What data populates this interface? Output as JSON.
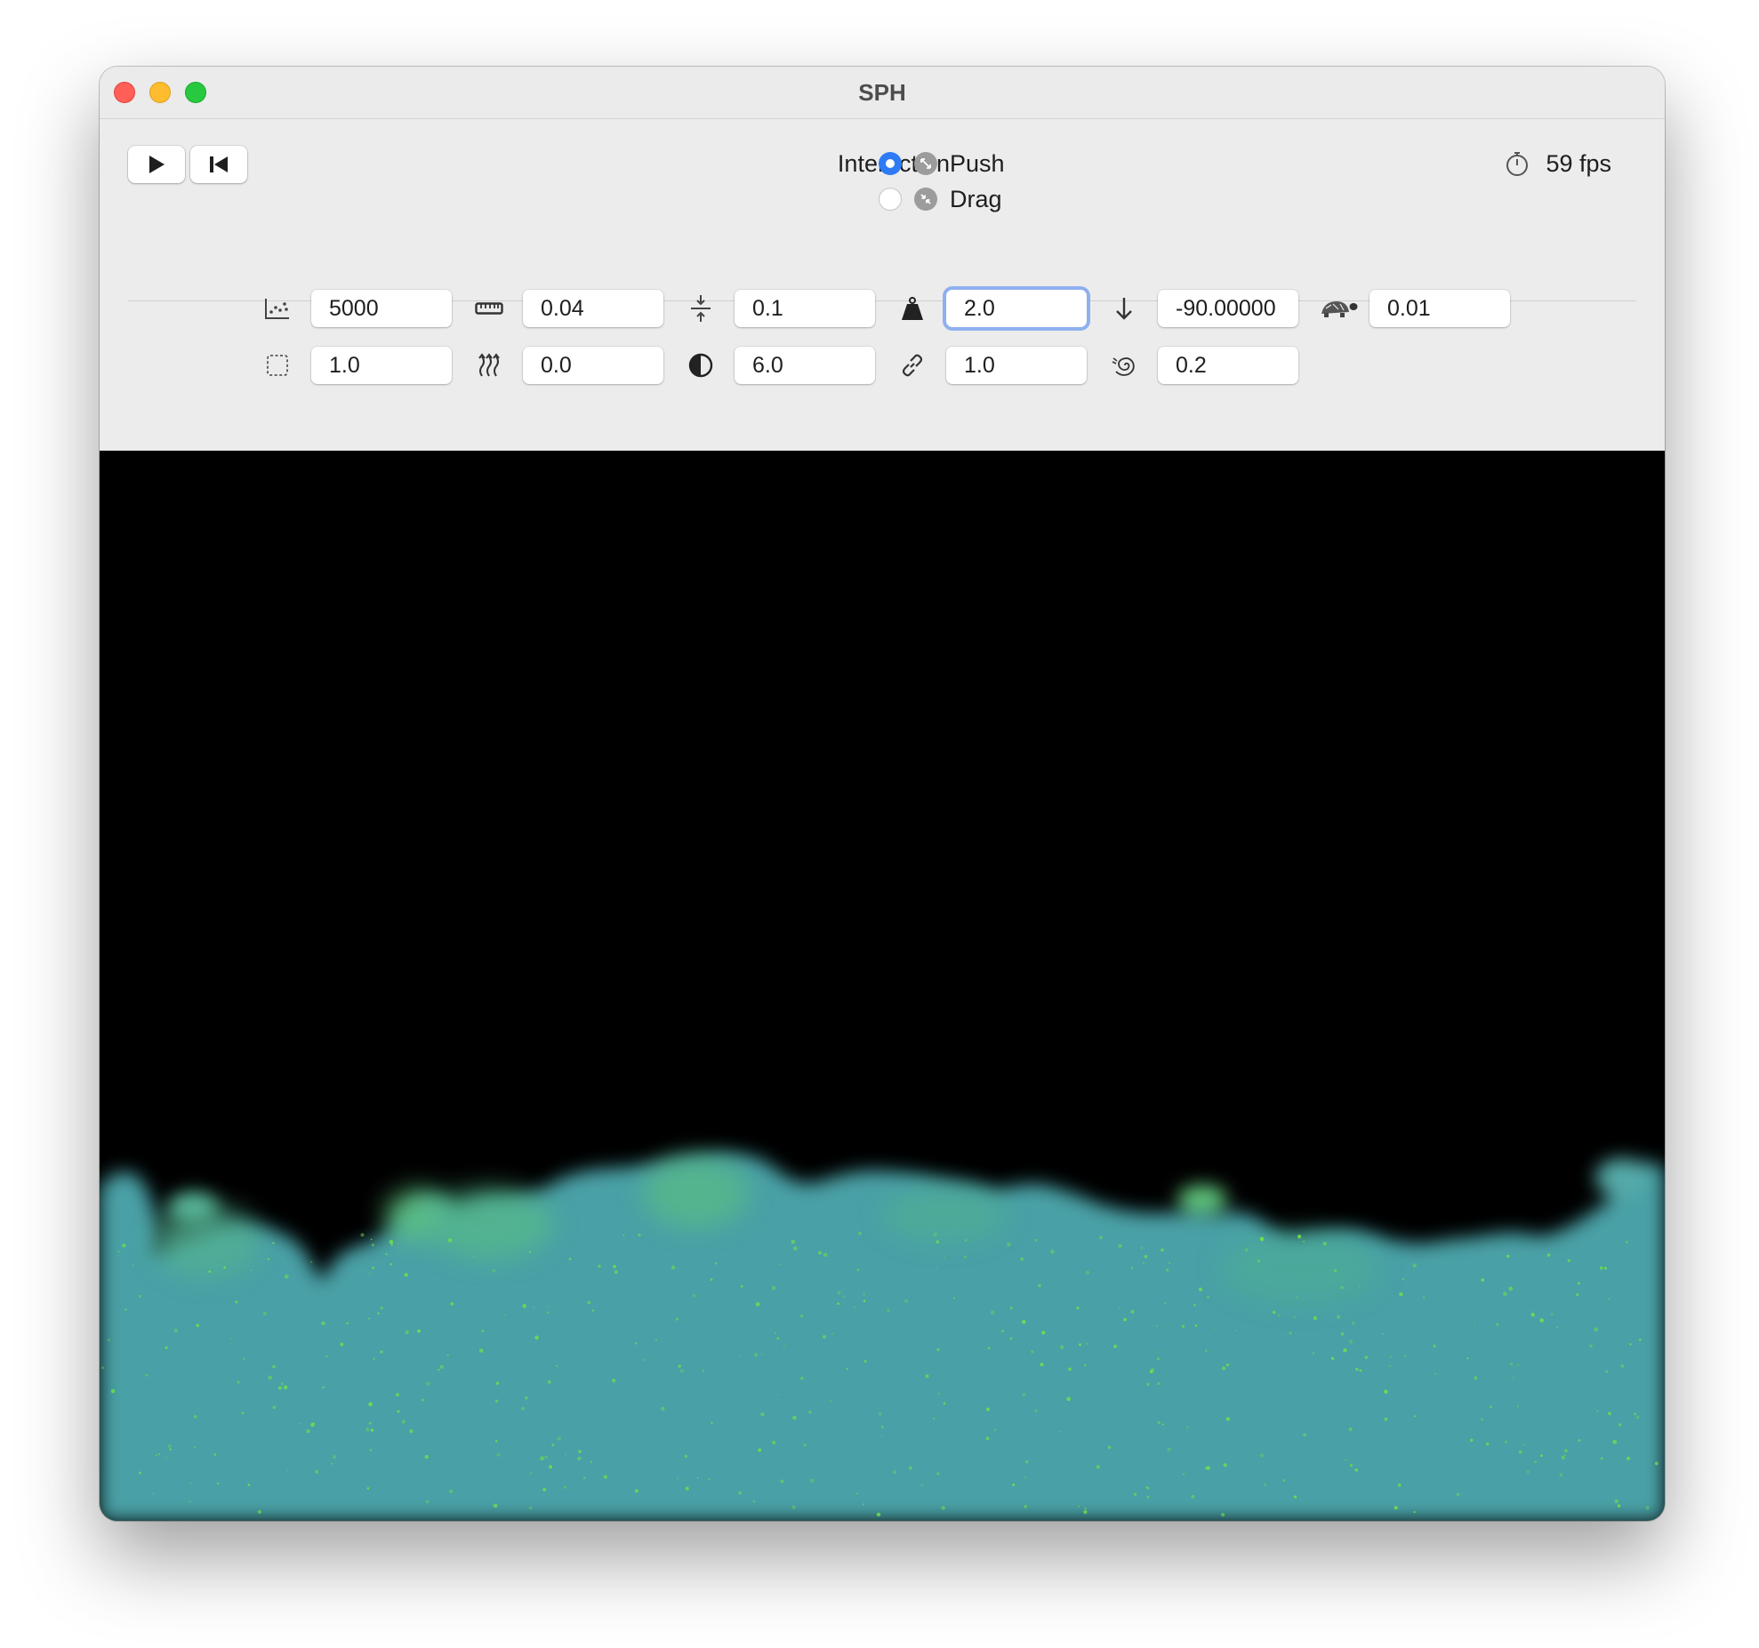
{
  "window": {
    "title": "SPH"
  },
  "toolbar": {
    "interaction_label": "Interaction",
    "modes": [
      {
        "label": "Push",
        "selected": true,
        "icon": "arrows-expand-icon"
      },
      {
        "label": "Drag",
        "selected": false,
        "icon": "arrows-collapse-icon"
      }
    ],
    "fps": "59 fps",
    "accent_color": "#2f7bf6"
  },
  "params": {
    "row1": [
      {
        "icon": "scatter-chart-icon",
        "value": "5000"
      },
      {
        "icon": "ruler-icon",
        "value": "0.04"
      },
      {
        "icon": "arrows-converge-icon",
        "value": "0.1"
      },
      {
        "icon": "weight-icon",
        "value": "2.0",
        "focused": true
      },
      {
        "icon": "arrow-down-icon",
        "value": "-90.00000"
      },
      {
        "icon": "tortoise-icon",
        "value": "0.01"
      }
    ],
    "row2": [
      {
        "icon": "dashed-square-icon",
        "value": "1.0"
      },
      {
        "icon": "heat-waves-icon",
        "value": "0.0"
      },
      {
        "icon": "half-circle-icon",
        "value": "6.0"
      },
      {
        "icon": "link-icon",
        "value": "1.0"
      },
      {
        "icon": "spiral-icon",
        "value": "0.2"
      }
    ]
  },
  "simulation": {
    "fluid_color": "#4ca5a8",
    "particle_color": "#6fe24a",
    "background": "#000000"
  }
}
